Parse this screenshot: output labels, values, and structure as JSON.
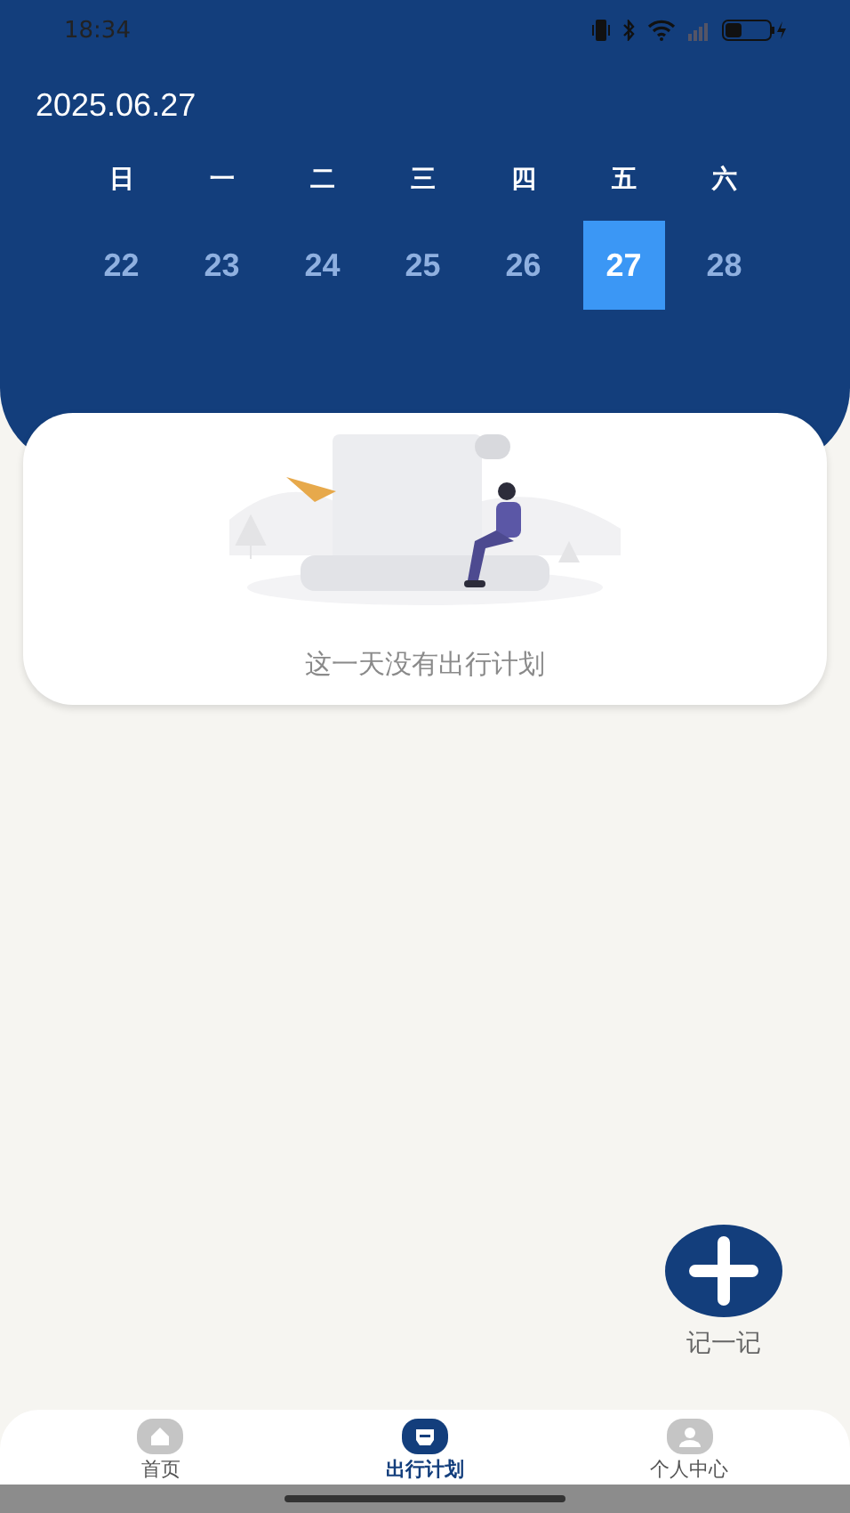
{
  "status_bar": {
    "time": "18:34"
  },
  "header": {
    "date": "2025.06.27"
  },
  "weekdays": [
    "日",
    "一",
    "二",
    "三",
    "四",
    "五",
    "六"
  ],
  "days": [
    {
      "label": "22",
      "selected": false
    },
    {
      "label": "23",
      "selected": false
    },
    {
      "label": "24",
      "selected": false
    },
    {
      "label": "25",
      "selected": false
    },
    {
      "label": "26",
      "selected": false
    },
    {
      "label": "27",
      "selected": true
    },
    {
      "label": "28",
      "selected": false
    }
  ],
  "empty_state": {
    "message": "这一天没有出行计划"
  },
  "fab": {
    "label": "记一记"
  },
  "tabs": [
    {
      "label": "首页",
      "kind": "home",
      "selected": false
    },
    {
      "label": "出行计划",
      "kind": "plan",
      "selected": true
    },
    {
      "label": "个人中心",
      "kind": "profile",
      "selected": false
    }
  ]
}
